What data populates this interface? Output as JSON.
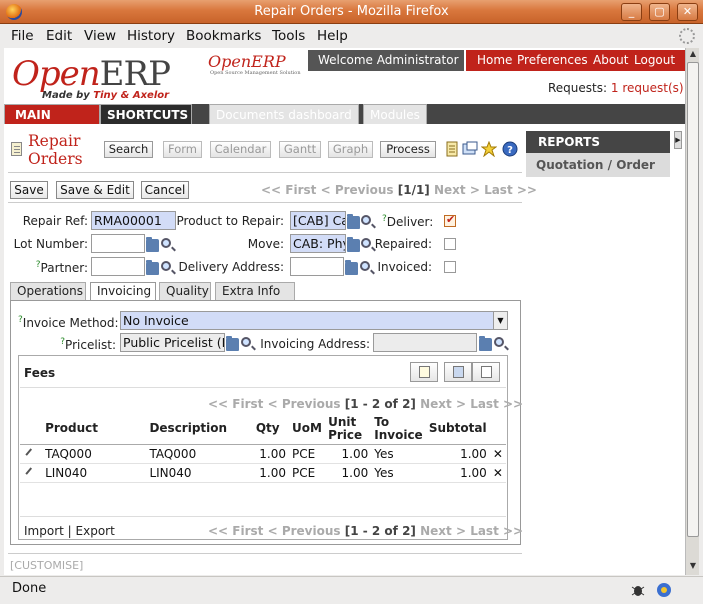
{
  "window": {
    "title": "Repair Orders - Mozilla Firefox"
  },
  "menubar": [
    "File",
    "Edit",
    "View",
    "History",
    "Bookmarks",
    "Tools",
    "Help"
  ],
  "header": {
    "logo_main": "Open",
    "logo_erp": "ERP",
    "logo_made_by": "Made by ",
    "logo_tiny_axelor": "Tiny & Axelor",
    "mini_logo": "OpenERP",
    "mini_logo_sub": "Open Source Management Solution",
    "welcome": "Welcome Administrator",
    "links": [
      "Home",
      "Preferences",
      "About",
      "Logout"
    ],
    "requests_label": "Requests:",
    "requests_value": "1 request(s)"
  },
  "nav": {
    "main_menu": "MAIN MENU",
    "shortcuts": "SHORTCUTS",
    "documents_dashboard": "Documents dashboard",
    "modules": "Modules"
  },
  "page": {
    "title_line1": "Repair",
    "title_line2": "Orders",
    "view_buttons": [
      "Search",
      "Form",
      "Calendar",
      "Gantt",
      "Graph",
      "Process"
    ]
  },
  "reports": {
    "title": "REPORTS",
    "item": "Quotation / Order"
  },
  "toolbar": {
    "save": "Save",
    "save_edit": "Save & Edit",
    "cancel": "Cancel",
    "pager_first": "<< First",
    "pager_prev": "< Previous",
    "pager_pos": "[1/1]",
    "pager_next": "Next >",
    "pager_last": "Last >>"
  },
  "form": {
    "repair_ref_label": "Repair Ref:",
    "repair_ref_value": "RMA00001",
    "product_label": "Product to Repair:",
    "product_value": "[CAB] Ca",
    "deliver_label": "Deliver:",
    "lot_label": "Lot Number:",
    "lot_value": "",
    "move_label": "Move:",
    "move_value": "CAB: Phy",
    "repaired_label": "Repaired:",
    "partner_label": "Partner:",
    "partner_value": "",
    "delivery_address_label": "Delivery Address:",
    "delivery_address_value": "",
    "invoiced_label": "Invoiced:",
    "deliver_checked": true,
    "repaired_checked": false,
    "invoiced_checked": false
  },
  "tabs": [
    "Operations",
    "Invoicing",
    "Quality",
    "Extra Info"
  ],
  "invoicing": {
    "invoice_method_label": "Invoice Method:",
    "invoice_method_value": "No Invoice",
    "pricelist_label": "Pricelist:",
    "pricelist_value": "Public Pricelist (E",
    "invoicing_address_label": "Invoicing Address:",
    "invoicing_address_value": ""
  },
  "fees": {
    "title": "Fees",
    "pager_first": "<< First",
    "pager_prev": "< Previous",
    "pager_pos": "[1 - 2 of 2]",
    "pager_next": "Next >",
    "pager_last": "Last >>",
    "columns": [
      "Product",
      "Description",
      "Qty",
      "UoM",
      "Unit Price",
      "To Invoice",
      "Subtotal"
    ],
    "rows": [
      {
        "product": "TAQ000",
        "description": "TAQ000",
        "qty": "1.00",
        "uom": "PCE",
        "unit_price": "1.00",
        "to_invoice": "Yes",
        "subtotal": "1.00"
      },
      {
        "product": "LIN040",
        "description": "LIN040",
        "qty": "1.00",
        "uom": "PCE",
        "unit_price": "1.00",
        "to_invoice": "Yes",
        "subtotal": "1.00"
      }
    ],
    "import": "Import",
    "separator": "|",
    "export": "Export"
  },
  "customise": "[CUSTOMISE]",
  "status": {
    "text": "Done"
  }
}
